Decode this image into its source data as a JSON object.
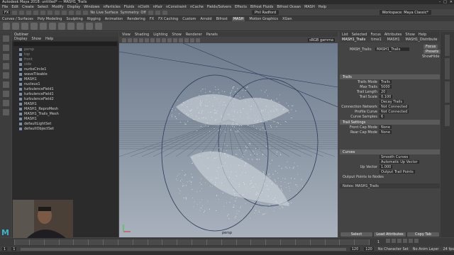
{
  "titlebar": {
    "title": "Autodesk Maya 2018: untitled*   ---   MASH1_Trails",
    "controls": [
      "–",
      "□",
      "✕"
    ]
  },
  "menubar": {
    "items": [
      "File",
      "Edit",
      "Create",
      "Select",
      "Modify",
      "Display",
      "Windows",
      "nParticles",
      "Fluids",
      "nCloth",
      "nHair",
      "nConstraint",
      "nCache",
      "Fields/Solvers",
      "Effects",
      "Bifrost Fluids",
      "Bifrost Ocean",
      "MASH",
      "Help"
    ]
  },
  "statusline": {
    "mode": "FX",
    "live_surface": "No Live Surface",
    "symmetry": "Symmetry: Off",
    "workspace": "Workspace:",
    "workspace_value": "Maya Classic*",
    "user": "Phil Radford"
  },
  "shelf": {
    "tabs": [
      "Curves / Surfaces",
      "Poly Modeling",
      "Sculpting",
      "Rigging",
      "Animation",
      "Rendering",
      "FX",
      "FX Caching",
      "Custom",
      "Arnold",
      "Bifrost",
      "MASH",
      "Motion Graphics",
      "XGen"
    ],
    "active_tab": "MASH"
  },
  "outliner": {
    "title": "Outliner",
    "menu": [
      "Display",
      "Show",
      "Help"
    ],
    "items": [
      {
        "label": "persp",
        "dim": true
      },
      {
        "label": "top",
        "dim": true
      },
      {
        "label": "front",
        "dim": true
      },
      {
        "label": "side",
        "dim": true
      },
      {
        "label": "nurbsCircle1",
        "dim": false
      },
      {
        "label": "waveTileable",
        "dim": false
      },
      {
        "label": "MASH1",
        "dim": false
      },
      {
        "label": "nucleus1",
        "dim": false
      },
      {
        "label": "turbulenceField1",
        "dim": false
      },
      {
        "label": "turbulenceField1",
        "dim": false
      },
      {
        "label": "turbulenceField2",
        "dim": false
      },
      {
        "label": "MASH1",
        "dim": false
      },
      {
        "label": "MASH1_ReproMesh",
        "dim": false
      },
      {
        "label": "MASH1_Trails_Mesh",
        "dim": false
      },
      {
        "label": "MASH1",
        "dim": false
      },
      {
        "label": "defaultLightSet",
        "dim": false
      },
      {
        "label": "defaultObjectSet",
        "dim": false
      }
    ]
  },
  "viewport": {
    "menu": [
      "View",
      "Shading",
      "Lighting",
      "Show",
      "Renderer",
      "Panels"
    ],
    "camera_label": "persp",
    "colorspace": "sRGB gamma"
  },
  "attribute_editor": {
    "tabs": [
      "List",
      "Selected",
      "Focus",
      "Attributes",
      "Show",
      "Help"
    ],
    "node_tabs": [
      "MASH1_Trails",
      "time1",
      "MASH1",
      "MASH1_Distribute"
    ],
    "node_type_label": "MASH_Trails:",
    "node_name": "MASH1_Trails",
    "buttons_right": [
      "Focus",
      "Presets",
      "Show",
      "Hide"
    ],
    "sections": {
      "trails": "Trails",
      "trail_settings": "Trail Settings",
      "curves": "Curves",
      "output_label": "Output Points to Nodes"
    },
    "fields": [
      {
        "label": "Trails Mode",
        "value": "Trails"
      },
      {
        "label": "Max Trails",
        "value": "5000"
      },
      {
        "label": "Trail Length",
        "value": "20"
      },
      {
        "label": "Trail Scale",
        "value": "0.100"
      },
      {
        "label": "",
        "value": "Decay Trails"
      },
      {
        "label": "Connection Network",
        "value": "Not Connected"
      },
      {
        "label": "Profile Curve",
        "value": "Not Connected"
      },
      {
        "label": "Curve Samples",
        "value": "6"
      }
    ],
    "trail_settings_fields": [
      {
        "label": "Front Cap Mode",
        "value": "None"
      },
      {
        "label": "Rear Cap Mode",
        "value": "None"
      }
    ],
    "curve_fields": [
      {
        "label": "",
        "value": "Smooth Curves"
      },
      {
        "label": "",
        "value": "Automatic Up Vector"
      },
      {
        "label": "Up Vector",
        "value": "1.000"
      },
      {
        "label": "",
        "value": "Output Trail Points"
      }
    ],
    "notes_label": "Notes: MASH1_Trails",
    "bottom_buttons": [
      "Select",
      "Load Attributes",
      "Copy Tab"
    ]
  },
  "timeline": {
    "start": "1",
    "end": "120",
    "current": "1",
    "fps": "24 fps",
    "range_start": "1",
    "range_end": "120",
    "character_set": "No Character Set",
    "anim_layer": "No Anim Layer"
  },
  "colors": {
    "accent": "#3fb4c9",
    "viewport_top": "#6e7c8e",
    "viewport_bottom": "#a8b1bc"
  }
}
